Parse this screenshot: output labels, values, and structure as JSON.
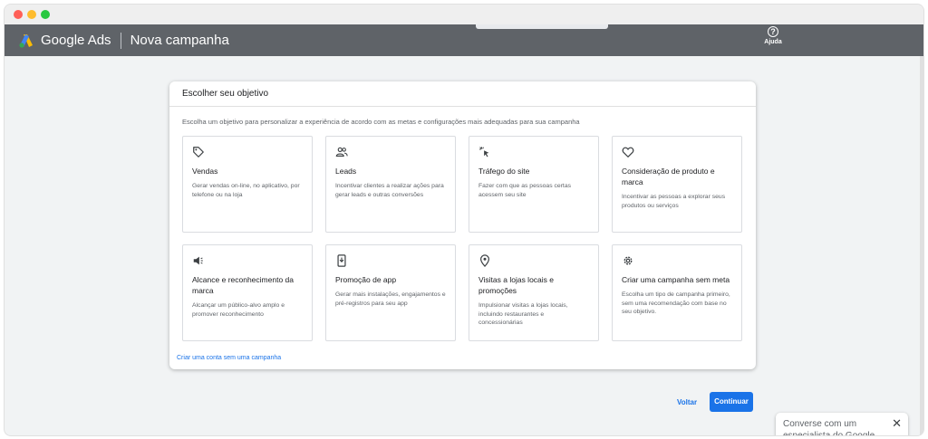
{
  "app": {
    "brand": "Google Ads",
    "page_title": "Nova campanha",
    "help_label": "Ajuda"
  },
  "dialog": {
    "title": "Escolher seu objetivo",
    "subtitle": "Escolha um objetivo para personalizar a experiência de acordo com as metas e configurações mais adequadas para sua campanha",
    "no_campaign_link": "Criar uma conta sem uma campanha",
    "cards": [
      {
        "icon": "tag-icon",
        "title": "Vendas",
        "desc": "Gerar vendas on-line, no aplicativo, por telefone ou na loja"
      },
      {
        "icon": "people-icon",
        "title": "Leads",
        "desc": "Incentivar clientes a realizar ações para gerar leads e outras conversões"
      },
      {
        "icon": "cursor-click-icon",
        "title": "Tráfego do site",
        "desc": "Fazer com que as pessoas certas acessem seu site"
      },
      {
        "icon": "heart-icon",
        "title": "Consideração de produto e marca",
        "desc": "Incentivar as pessoas a explorar seus produtos ou serviços"
      },
      {
        "icon": "megaphone-icon",
        "title": "Alcance e reconhecimento da marca",
        "desc": "Alcançar um público-alvo amplo e promover reconhecimento"
      },
      {
        "icon": "phone-download-icon",
        "title": "Promoção de app",
        "desc": "Gerar mais instalações, engajamentos e pré-registros para seu app"
      },
      {
        "icon": "location-pin-icon",
        "title": "Visitas a lojas locais e promoções",
        "desc": "Impulsionar visitas a lojas locais, incluindo restaurantes e concessionárias"
      },
      {
        "icon": "gear-icon",
        "title": "Criar uma campanha sem meta",
        "desc": "Escolha um tipo de campanha primeiro, sem uma recomendação com base no seu objetivo."
      }
    ]
  },
  "footer": {
    "back_label": "Voltar",
    "continue_label": "Continuar"
  },
  "chat": {
    "text": "Converse com um especialista do Google Ads",
    "close_icon": "close-icon"
  },
  "colors": {
    "appbar": "#5f6368",
    "accent": "#1a73e8",
    "background": "#f1f3f4"
  }
}
